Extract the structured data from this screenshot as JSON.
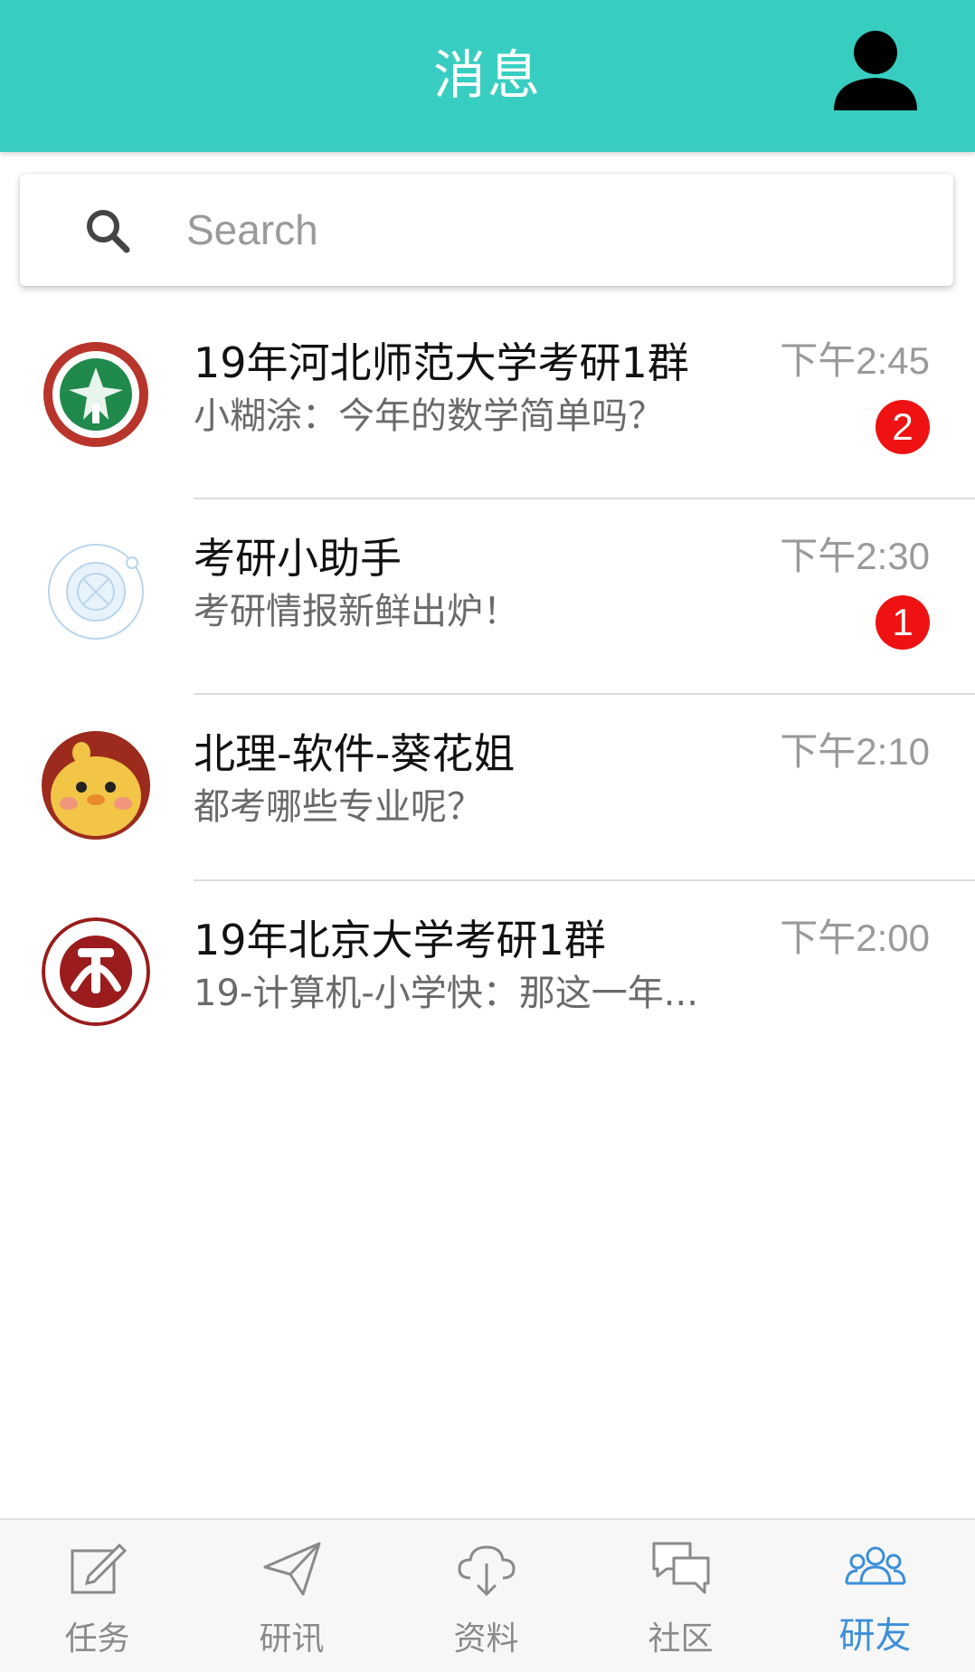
{
  "header": {
    "title": "消息",
    "profile_icon": "user-icon"
  },
  "search": {
    "placeholder": "Search",
    "icon": "search-icon"
  },
  "chats": [
    {
      "name": "19年河北师范大学考研1群",
      "preview": "小糊涂：今年的数学简单吗？",
      "time": "下午2:45",
      "badge": "2",
      "avatar": "beijing-tech-logo"
    },
    {
      "name": "考研小助手",
      "preview": "考研情报新鲜出炉！",
      "time": "下午2:30",
      "badge": "1",
      "avatar": "assistant-logo"
    },
    {
      "name": "北理-软件-葵花姐",
      "preview": "都考哪些专业呢？",
      "time": "下午2:10",
      "avatar": "chick-photo"
    },
    {
      "name": "19年北京大学考研1群",
      "preview": "19-计算机-小学快：那这一年...",
      "time": "下午2:00",
      "avatar": "peking-university-logo"
    }
  ],
  "tabs": [
    {
      "label": "任务",
      "icon": "edit-icon",
      "active": false
    },
    {
      "label": "研讯",
      "icon": "paper-plane-icon",
      "active": false
    },
    {
      "label": "资料",
      "icon": "cloud-download-icon",
      "active": false
    },
    {
      "label": "社区",
      "icon": "chat-bubbles-icon",
      "active": false
    },
    {
      "label": "研友",
      "icon": "friends-icon",
      "active": true
    }
  ],
  "colors": {
    "header": "#37cec1",
    "badge": "#ee1212",
    "active_tab": "#3d8fd8"
  }
}
